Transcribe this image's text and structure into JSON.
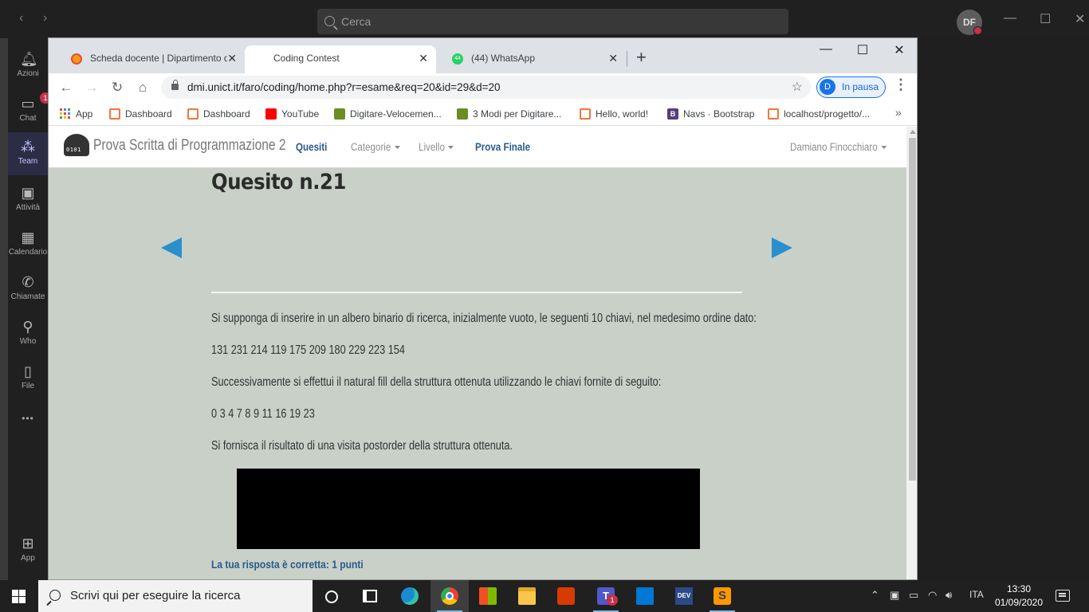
{
  "teams": {
    "search_placeholder": "Cerca",
    "avatar_initials": "DF",
    "rail": [
      {
        "label": "Azioni"
      },
      {
        "label": "Chat",
        "badge": "1"
      },
      {
        "label": "Team"
      },
      {
        "label": "Attività"
      },
      {
        "label": "Calendario"
      },
      {
        "label": "Chiamate"
      },
      {
        "label": "Who"
      },
      {
        "label": "File"
      },
      {
        "label": "App"
      }
    ],
    "more_label": "•••"
  },
  "browser": {
    "tabs": [
      {
        "title": "Scheda docente | Dipartimento di",
        "active": false
      },
      {
        "title": "Coding Contest",
        "active": true
      },
      {
        "title": "(44) WhatsApp",
        "active": false,
        "badge": "44"
      }
    ],
    "url": "dmi.unict.it/faro/coding/home.php?r=esame&req=20&id=29&d=20",
    "profile": {
      "initial": "D",
      "status": "In pausa"
    },
    "bookmarks": [
      {
        "label": "App",
        "icon": "apps-grid-icon"
      },
      {
        "label": "Dashboard",
        "icon": "xampp-icon"
      },
      {
        "label": "Dashboard",
        "icon": "xampp-icon"
      },
      {
        "label": "YouTube",
        "icon": "youtube-icon"
      },
      {
        "label": "Digitare-Velocemen...",
        "icon": "globe-icon"
      },
      {
        "label": "3 Modi per Digitare...",
        "icon": "globe-icon"
      },
      {
        "label": "Hello, world!",
        "icon": "xampp-icon"
      },
      {
        "label": "Navs · Bootstrap",
        "icon": "bootstrap-icon"
      },
      {
        "label": "localhost/progetto/...",
        "icon": "xampp-icon"
      }
    ]
  },
  "site": {
    "brand": "Prova Scritta di Programmazione 2",
    "nav": {
      "quesiti": "Quesiti",
      "categorie": "Categorie",
      "livello": "Livello",
      "prova_finale": "Prova Finale",
      "user": "Damiano Finocchiaro"
    },
    "question": {
      "title": "Quesito n.21",
      "p1": "Si supponga di inserire in un albero binario di ricerca, inizialmente vuoto, le seguenti 10 chiavi, nel medesimo ordine dato:",
      "keys": "131 231 214 119 175 209 180 229 223 154",
      "p2": "Successivamente si effettui il natural fill della struttura ottenuta utilizzando le chiavi fornite di seguito:",
      "fill_keys": "0 3 4 7 8 9 11 16 19 23",
      "p3": "Si fornisca il risultato di una visita postorder della struttura ottenuta.",
      "result": "La tua risposta è corretta: 1 punti"
    }
  },
  "taskbar": {
    "search_placeholder": "Scrivi qui per eseguire la ricerca",
    "teams_badge": "1",
    "language": "ITA",
    "time": "13:30",
    "date": "01/09/2020"
  },
  "colors": {
    "page_bg": "#c8d0c8",
    "link_blue": "#2a5a8a",
    "arrow_blue": "#2a8fcc",
    "profile_blue": "#1a73e8"
  }
}
